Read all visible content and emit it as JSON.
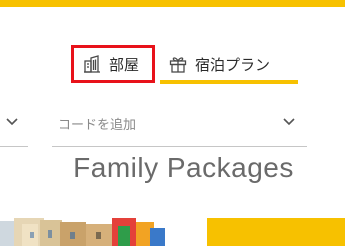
{
  "tabs": {
    "rooms": {
      "label": "部屋",
      "icon": "building-icon"
    },
    "plans": {
      "label": "宿泊プラン",
      "icon": "gift-icon"
    }
  },
  "filters": {
    "left_select": {
      "icon": "chevron-down-icon"
    },
    "code_select": {
      "placeholder": "コードを追加",
      "icon": "chevron-down-icon"
    }
  },
  "section": {
    "heading": "Family Packages"
  },
  "colors": {
    "accent": "#f7c100",
    "highlight": "#e8121a",
    "text": "#2b2b2b",
    "heading": "#6a6a6a",
    "placeholder": "#8a8a8a"
  }
}
